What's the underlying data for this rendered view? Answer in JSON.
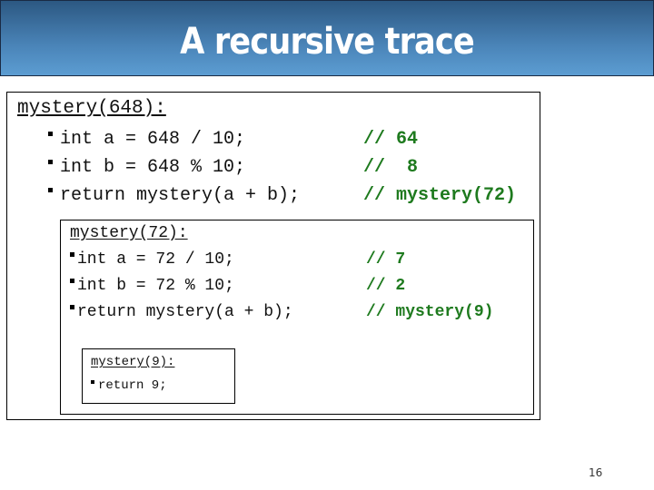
{
  "slide": {
    "title": "A recursive trace",
    "page_number": "16"
  },
  "frames": [
    {
      "call": "mystery(648):",
      "lines": [
        {
          "code": "int a = 648 / 10;",
          "comment": "// 64"
        },
        {
          "code": "int b = 648 % 10;",
          "comment": "//  8"
        },
        {
          "code": "return mystery(a + b);",
          "comment": "// mystery(72)"
        }
      ]
    },
    {
      "call": "mystery(72):",
      "lines": [
        {
          "code": "int a = 72 / 10;",
          "comment": "// 7"
        },
        {
          "code": "int b = 72 % 10;",
          "comment": "// 2"
        },
        {
          "code": "return mystery(a + b);",
          "comment": "// mystery(9)"
        }
      ]
    },
    {
      "call": "mystery(9):",
      "lines": [
        {
          "code": "return 9;"
        }
      ]
    }
  ],
  "colors": {
    "comment": "#1e7a1e",
    "header_top": "#2c5882",
    "header_bottom": "#5c9dd2"
  }
}
